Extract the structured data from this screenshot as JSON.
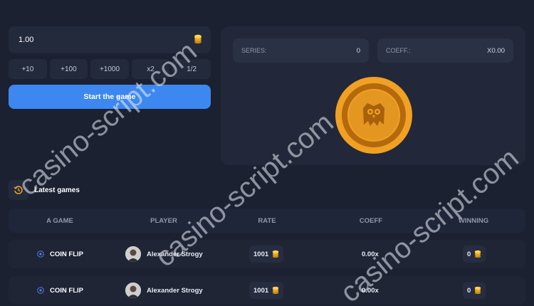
{
  "bet": {
    "amount": "1.00",
    "currency_icon": "coin-stack-icon"
  },
  "quick_buttons": [
    "+10",
    "+100",
    "+1000",
    "x2",
    "1/2"
  ],
  "start_button": "Start the game",
  "stats": {
    "series_label": "SERIES:",
    "series_value": "0",
    "coeff_label": "COEFF.:",
    "coeff_value": "X0.00"
  },
  "history": {
    "title": "Latest games",
    "columns": [
      "A GAME",
      "PLAYER",
      "RATE",
      "COEFF",
      "WINNING"
    ],
    "rows": [
      {
        "game": "COIN FLIP",
        "player": "Alexander Strogy",
        "rate": "1001",
        "coeff": "0.00x",
        "winning": "0"
      },
      {
        "game": "COIN FLIP",
        "player": "Alexander Strogy",
        "rate": "1001",
        "coeff": "0.00x",
        "winning": "0"
      }
    ]
  },
  "watermark": "casino-script.com",
  "colors": {
    "accent": "#3d87f0",
    "coin": "#f0a023",
    "bg": "#1b2131"
  }
}
